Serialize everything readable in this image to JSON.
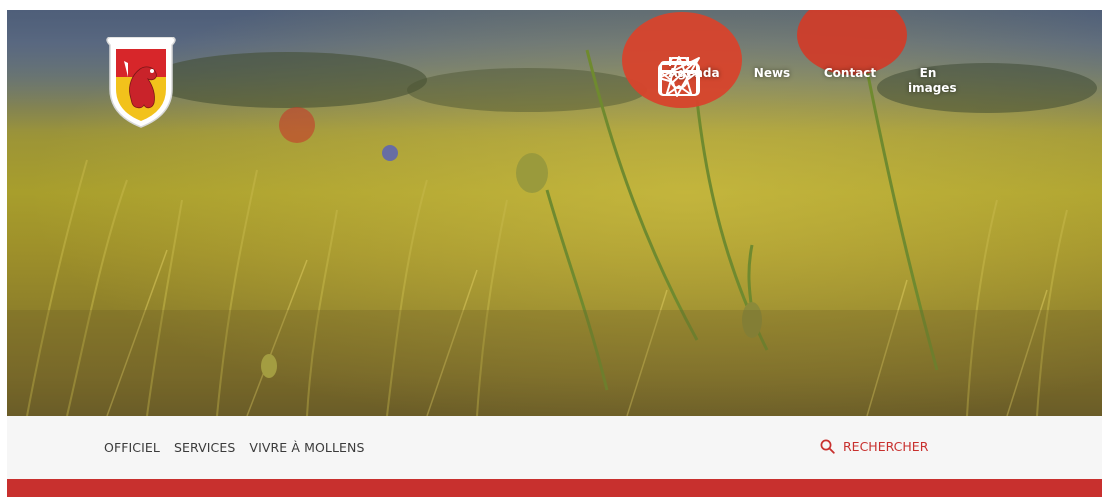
{
  "header": {
    "logo_icon": "coat-of-arms-lion-icon",
    "quicklinks": [
      {
        "label": "Agenda",
        "icon": "calendar-icon"
      },
      {
        "label": "News",
        "icon": "star-icon"
      },
      {
        "label": "Contact",
        "icon": "paper-plane-icon"
      },
      {
        "label": "En images",
        "icon": "camera-icon"
      }
    ]
  },
  "nav": {
    "items": [
      "OFFICIEL",
      "SERVICES",
      "VIVRE À MOLLENS"
    ],
    "search_label": "RECHERCHER",
    "search_icon": "search-icon"
  },
  "colors": {
    "accent": "#c8302e",
    "navbar_bg": "#f6f6f6",
    "nav_text": "#3b3b3b"
  }
}
